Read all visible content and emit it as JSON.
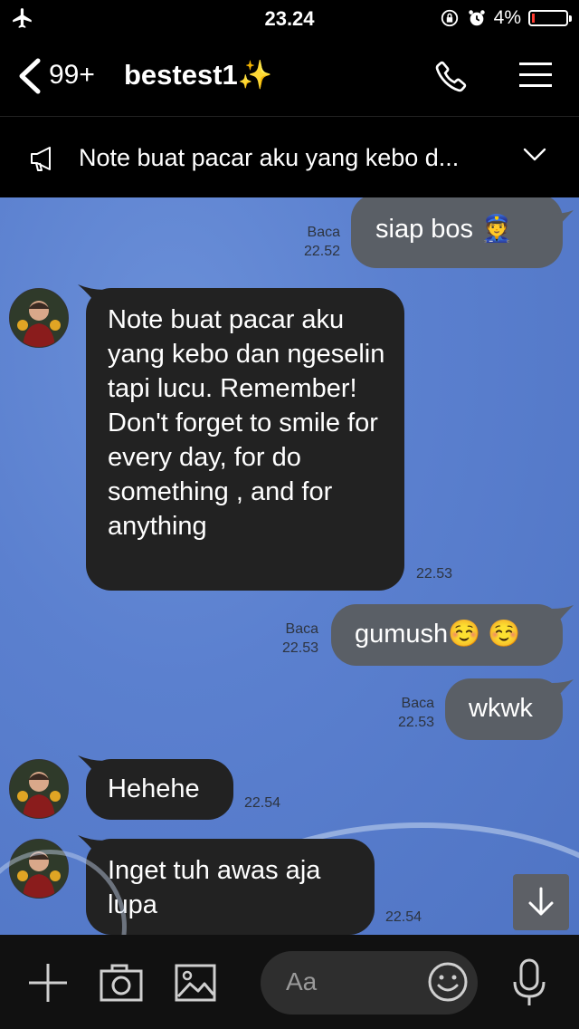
{
  "status": {
    "time": "23.24",
    "battery": "4%"
  },
  "header": {
    "back_count": "99+",
    "title": "bestest1✨"
  },
  "notice": {
    "text": "Note buat pacar aku yang kebo d..."
  },
  "messages": [
    {
      "dir": "out",
      "text": "siap bos 👮",
      "read": "Baca",
      "time": "22.52"
    },
    {
      "dir": "in",
      "text": "Note buat pacar aku yang kebo dan ngeselin tapi lucu. Remember! Don't forget to smile for every day, for do something , and for anything",
      "time": "22.53"
    },
    {
      "dir": "out",
      "text": "gumush☺️ ☺️",
      "read": "Baca",
      "time": "22.53"
    },
    {
      "dir": "out",
      "text": "wkwk",
      "read": "Baca",
      "time": "22.53"
    },
    {
      "dir": "in",
      "text": "Hehehe",
      "time": "22.54"
    },
    {
      "dir": "in",
      "text": "Inget tuh awas aja lupa",
      "time": "22.54"
    }
  ],
  "input": {
    "placeholder": "Aa"
  },
  "icons": [
    "airplane-icon",
    "lock-rotation-icon",
    "alarm-icon",
    "battery-icon",
    "back-chevron-icon",
    "phone-icon",
    "menu-icon",
    "megaphone-icon",
    "chevron-down-icon",
    "scroll-down-icon",
    "plus-icon",
    "camera-icon",
    "image-icon",
    "emoji-icon",
    "mic-icon"
  ]
}
